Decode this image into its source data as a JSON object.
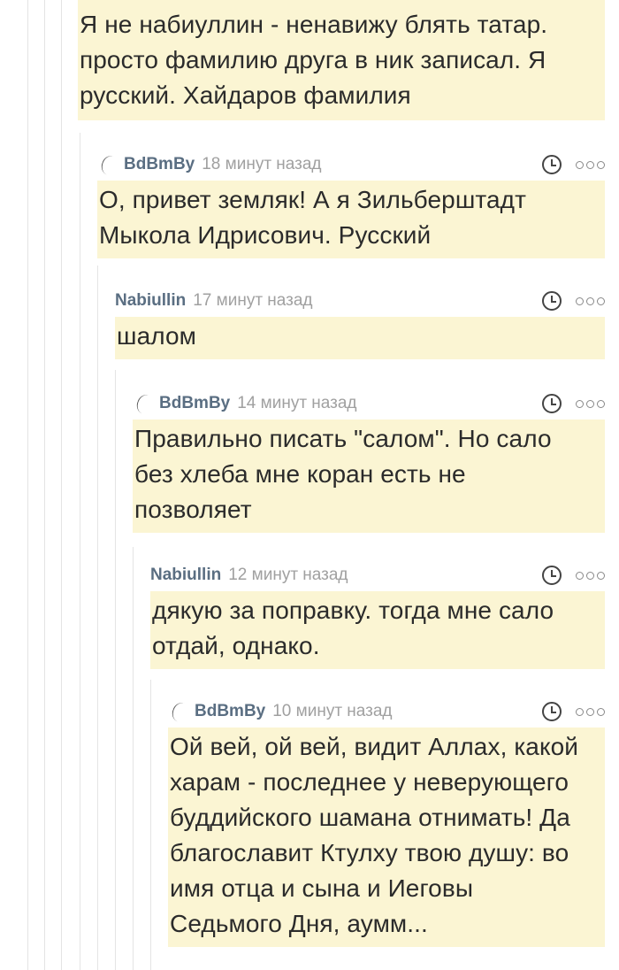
{
  "top_comment": {
    "text": "Я не набиуллин - ненавижу блять татар.\nпросто фамилию друга в ник записал. Я\nрусский. Хайдаров фамилия"
  },
  "comments": [
    {
      "author": "BdBmBy",
      "time": "18 минут назад",
      "has_avatar": true,
      "text": "О, привет земляк! А я Зильберштадт\nМыкола Идрисович. Русский"
    },
    {
      "author": "Nabiullin",
      "time": "17 минут назад",
      "has_avatar": false,
      "text": "шалом"
    },
    {
      "author": "BdBmBy",
      "time": "14 минут назад",
      "has_avatar": true,
      "text": "Правильно писать \"салом\". Но сало\nбез хлеба мне коран есть не\nпозволяет"
    },
    {
      "author": "Nabiullin",
      "time": "12 минут назад",
      "has_avatar": false,
      "text": "дякую за поправку. тогда мне сало\nотдай, однако."
    },
    {
      "author": "BdBmBy",
      "time": "10 минут назад",
      "has_avatar": true,
      "text": "Ой вей, ой вей, видит Аллах, какой\nхарам - последнее у неверующего\nбуддийского шамана отнимать! Да\nблагославит Ктулху твою душу: во\nимя отца и сына и Иеговы\nСедьмого Дня, аумм..."
    }
  ],
  "icons": {
    "time": "clock-icon",
    "more": "more-options-icon"
  }
}
